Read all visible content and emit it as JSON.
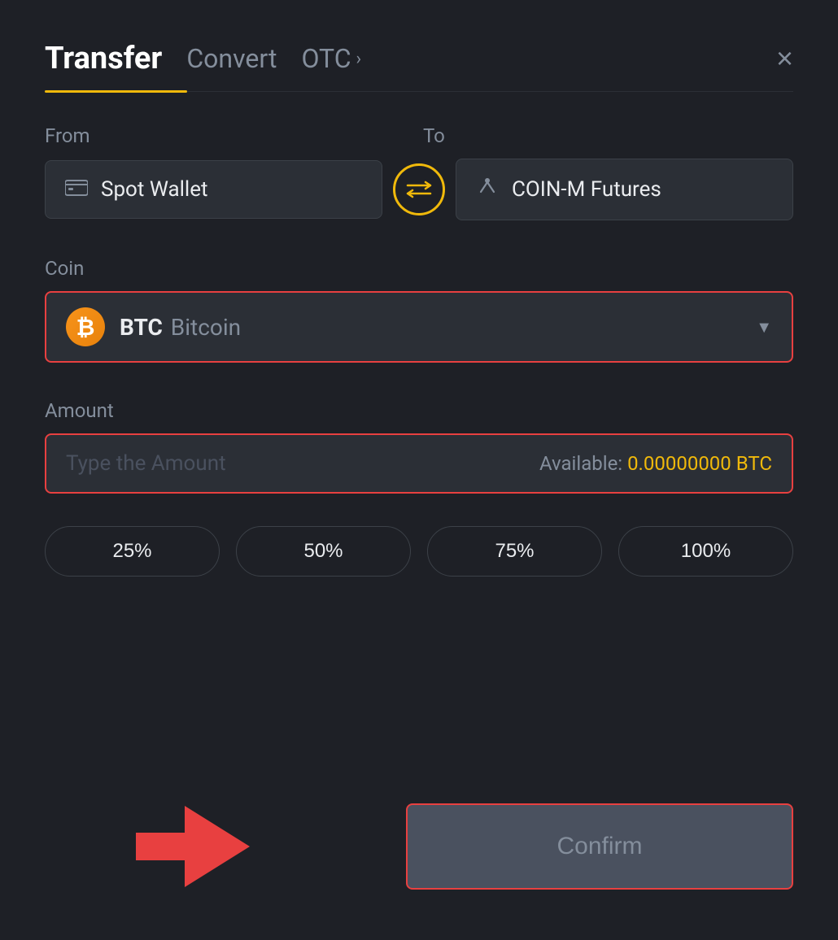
{
  "header": {
    "tab_transfer": "Transfer",
    "tab_convert": "Convert",
    "tab_otc": "OTC",
    "close_label": "×"
  },
  "from_section": {
    "label": "From",
    "wallet": "Spot Wallet"
  },
  "to_section": {
    "label": "To",
    "wallet": "COIN-M Futures"
  },
  "coin_section": {
    "label": "Coin",
    "coin_symbol": "BTC",
    "coin_name": "Bitcoin"
  },
  "amount_section": {
    "label": "Amount",
    "placeholder": "Type the Amount",
    "available_label": "Available:",
    "available_value": "0.00000000 BTC"
  },
  "percent_buttons": [
    {
      "label": "25%"
    },
    {
      "label": "50%"
    },
    {
      "label": "75%"
    },
    {
      "label": "100%"
    }
  ],
  "confirm_button": {
    "label": "Confirm"
  },
  "colors": {
    "active_tab_underline": "#f0b90b",
    "highlight_border": "#e84040",
    "swap_btn_color": "#f0b90b",
    "available_value_color": "#f0b90b"
  }
}
